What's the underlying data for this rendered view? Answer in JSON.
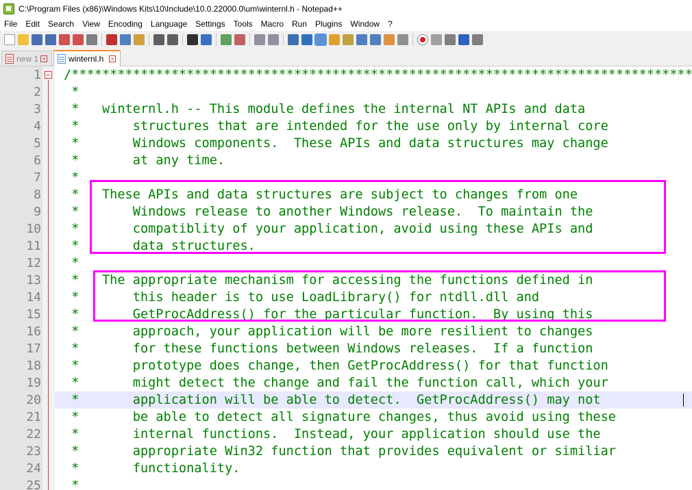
{
  "window": {
    "title": "C:\\Program Files (x86)\\Windows Kits\\10\\Include\\10.0.22000.0\\um\\winternl.h - Notepad++"
  },
  "menu": [
    "File",
    "Edit",
    "Search",
    "View",
    "Encoding",
    "Language",
    "Settings",
    "Tools",
    "Macro",
    "Run",
    "Plugins",
    "Window",
    "?"
  ],
  "tabs": [
    {
      "label": "new 1",
      "active": false
    },
    {
      "label": "winternl.h",
      "active": true
    }
  ],
  "editor": {
    "current_line": 20,
    "lines": [
      {
        "num": "1",
        "text": "/*******************************************************************************************************"
      },
      {
        "num": "2",
        "text": " *"
      },
      {
        "num": "3",
        "text": " *   winternl.h -- This module defines the internal NT APIs and data"
      },
      {
        "num": "4",
        "text": " *       structures that are intended for the use only by internal core"
      },
      {
        "num": "5",
        "text": " *       Windows components.  These APIs and data structures may change"
      },
      {
        "num": "6",
        "text": " *       at any time."
      },
      {
        "num": "7",
        "text": " *"
      },
      {
        "num": "8",
        "text": " *   These APIs and data structures are subject to changes from one"
      },
      {
        "num": "9",
        "text": " *       Windows release to another Windows release.  To maintain the"
      },
      {
        "num": "10",
        "text": " *       compatiblity of your application, avoid using these APIs and"
      },
      {
        "num": "11",
        "text": " *       data structures."
      },
      {
        "num": "12",
        "text": " *"
      },
      {
        "num": "13",
        "text": " *   The appropriate mechanism for accessing the functions defined in"
      },
      {
        "num": "14",
        "text": " *       this header is to use LoadLibrary() for ntdll.dll and"
      },
      {
        "num": "15",
        "text": " *       GetProcAddress() for the particular function.  By using this"
      },
      {
        "num": "16",
        "text": " *       approach, your application will be more resilient to changes"
      },
      {
        "num": "17",
        "text": " *       for these functions between Windows releases.  If a function"
      },
      {
        "num": "18",
        "text": " *       prototype does change, then GetProcAddress() for that function"
      },
      {
        "num": "19",
        "text": " *       might detect the change and fail the function call, which your"
      },
      {
        "num": "20",
        "text": " *       application will be able to detect.  GetProcAddress() may not"
      },
      {
        "num": "21",
        "text": " *       be able to detect all signature changes, thus avoid using these"
      },
      {
        "num": "22",
        "text": " *       internal functions.  Instead, your application should use the"
      },
      {
        "num": "23",
        "text": " *       appropriate Win32 function that provides equivalent or similiar"
      },
      {
        "num": "24",
        "text": " *       functionality."
      },
      {
        "num": "25",
        "text": " *"
      }
    ]
  },
  "colors": {
    "comment": "#008000",
    "highlight_box": "#ff00ff",
    "current_line_bg": "#e8e8ff",
    "tab_accent": "#fa8a2c"
  }
}
